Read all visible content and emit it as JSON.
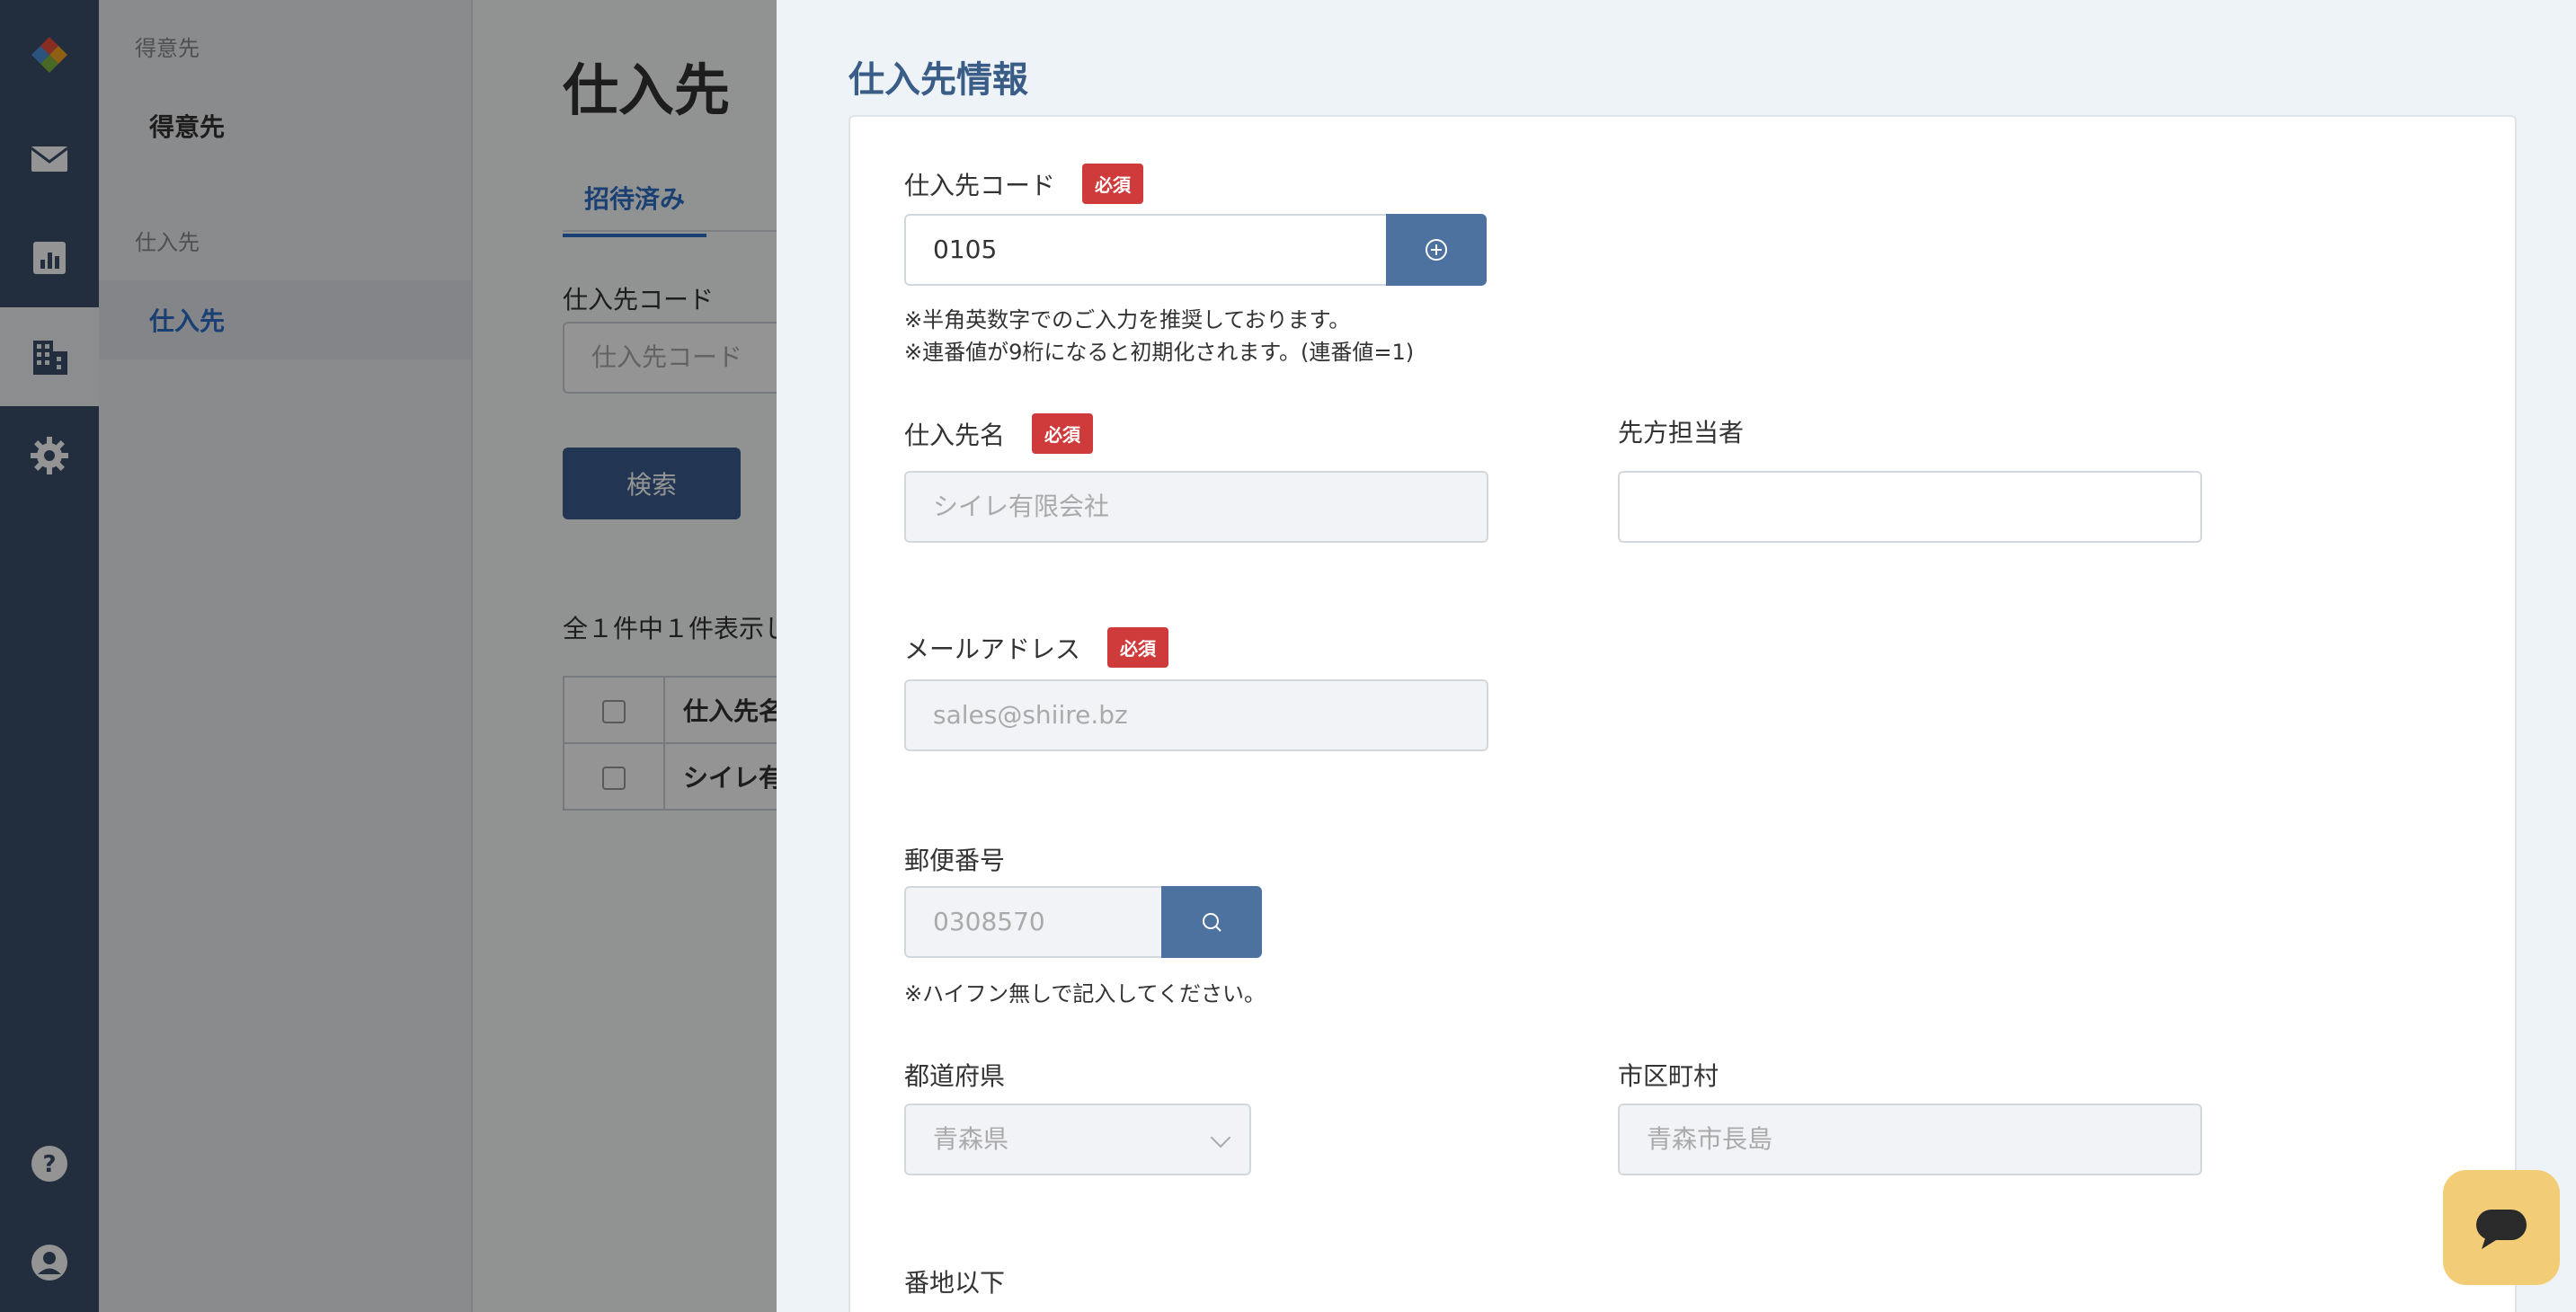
{
  "sidebar": {
    "groups": [
      {
        "title": "得意先",
        "items": [
          "得意先"
        ]
      },
      {
        "title": "仕入先",
        "items": [
          "仕入先"
        ]
      }
    ]
  },
  "main": {
    "title": "仕入先",
    "tab_invited": "招待済み",
    "code_label": "仕入先コード",
    "code_placeholder": "仕入先コード",
    "search_button": "検索",
    "result_count": "全１件中１件表示し",
    "table": {
      "header": "仕入先名",
      "rows": [
        {
          "name": "シイレ有"
        }
      ]
    }
  },
  "drawer": {
    "title": "仕入先情報",
    "required_badge": "必須",
    "code": {
      "label": "仕入先コード",
      "value": "0105",
      "hint1": "※半角英数字でのご入力を推奨しております。",
      "hint2": "※連番値が9桁になると初期化されます。(連番値=1)"
    },
    "name": {
      "label": "仕入先名",
      "placeholder": "シイレ有限会社"
    },
    "contact": {
      "label": "先方担当者",
      "value": ""
    },
    "email": {
      "label": "メールアドレス",
      "placeholder": "sales@shiire.bz"
    },
    "postal": {
      "label": "郵便番号",
      "placeholder": "0308570",
      "hint": "※ハイフン無しで記入してください。"
    },
    "prefecture": {
      "label": "都道府県",
      "selected": "青森県"
    },
    "city": {
      "label": "市区町村",
      "placeholder": "青森市長島"
    },
    "address": {
      "label": "番地以下"
    }
  },
  "colors": {
    "rail": "#3b4e6b",
    "accent": "#2d6fc7",
    "required": "#cf3b3b",
    "action_button": "#4d729f",
    "chat": "#f3cc78"
  },
  "icons": {
    "rail": [
      "logo-icon",
      "mail-icon",
      "chart-icon",
      "building-icon",
      "gear-icon",
      "help-icon",
      "user-icon"
    ],
    "code_add": "plus-circle-icon",
    "postal_search": "search-icon",
    "chat": "chat-icon"
  }
}
